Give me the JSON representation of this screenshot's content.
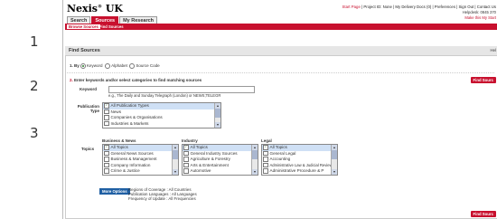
{
  "steps": [
    "1",
    "2",
    "3"
  ],
  "app": {
    "logo": "Nexis",
    "logo_sup": "®",
    "logo_rest": " UK",
    "toplinks": [
      "Start Page",
      "Project ID: None",
      "My Delivery Docs (0)",
      "Preferences",
      "Sign Out",
      "Contact Us"
    ],
    "helpdesk": "Helpdesk: 0845 370",
    "make_home": "Make this My Start"
  },
  "tabs": [
    {
      "label": "Search",
      "active": false
    },
    {
      "label": "Sources",
      "active": true
    },
    {
      "label": "My Research",
      "active": false
    }
  ],
  "subtabs": {
    "browse": "Browse Sources",
    "find": "Find Sources"
  },
  "find": {
    "title": "Find Sources",
    "help": "Hel",
    "by_label": "1. By",
    "by_options": [
      "Keyword",
      "Alphabet",
      "Source Code"
    ],
    "step2_num": "2.",
    "step2_text": "Enter keywords and/or select categories to find matching sources",
    "keyword_label": "Keyword",
    "keyword_example": "e.g., The Daily and Sunday Telegraph (London) or NEWS;TELEGR",
    "find_button": "Find Sourc",
    "pubtype_label": "Publication Type",
    "pubtypes": [
      {
        "label": "All Publication Types",
        "checked": true
      },
      {
        "label": "News",
        "checked": false
      },
      {
        "label": "Companies & Organisations",
        "checked": false
      },
      {
        "label": "Industries & Markets",
        "checked": false
      }
    ],
    "topics_label": "Topics",
    "columns": [
      {
        "header": "Business & News",
        "items": [
          {
            "label": "All Topics",
            "checked": true
          },
          {
            "label": "General News Sources",
            "checked": false
          },
          {
            "label": "Business & Management",
            "checked": false
          },
          {
            "label": "Company Information",
            "checked": false
          },
          {
            "label": "Crime & Justice",
            "checked": false
          }
        ]
      },
      {
        "header": "Industry",
        "items": [
          {
            "label": "All Topics",
            "checked": true
          },
          {
            "label": "General Industry Sources",
            "checked": false
          },
          {
            "label": "Agriculture & Forestry",
            "checked": false
          },
          {
            "label": "Arts & Entertainment",
            "checked": false
          },
          {
            "label": "Automotive",
            "checked": false
          }
        ]
      },
      {
        "header": "Legal",
        "items": [
          {
            "label": "All Topics",
            "checked": true
          },
          {
            "label": "General Legal",
            "checked": false
          },
          {
            "label": "Accounting",
            "checked": false
          },
          {
            "label": "Administrative Law & Judicial Review",
            "checked": false
          },
          {
            "label": "Administrative Procedure & P",
            "checked": false
          }
        ]
      }
    ],
    "more_options": "More Options",
    "info_lines": [
      "Regions of Coverage : All Countries",
      "Publication Languages : All Languages",
      "Frequency of Update : All Frequencies"
    ],
    "find_button_bottom": "Find Sourc"
  }
}
